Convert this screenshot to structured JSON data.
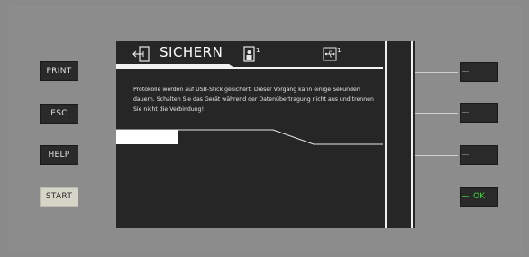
{
  "left_keys": [
    "PRINT",
    "ESC",
    "HELP",
    "START"
  ],
  "screen": {
    "title": "SICHERN",
    "user_badge": "1",
    "usb_badge": "1",
    "message": "Protokolle werden auf USB-Stick gesichert. Dieser Vorgang kann einige Sekunden dauern. Schalten Sie das Gerät während der Datenübertragung nicht aus und trennen Sie nicht die Verbindung!",
    "progress": 0.23
  },
  "right_keys": [
    "",
    "",
    "",
    "OK"
  ],
  "icons": {
    "header_left": "backup-arrow-icon",
    "header_user": "user-icon",
    "header_usb": "usb-icon"
  },
  "colors": {
    "screen_bg": "#262626",
    "ok_text": "#38d838",
    "start_key": "#d6d6c8"
  }
}
